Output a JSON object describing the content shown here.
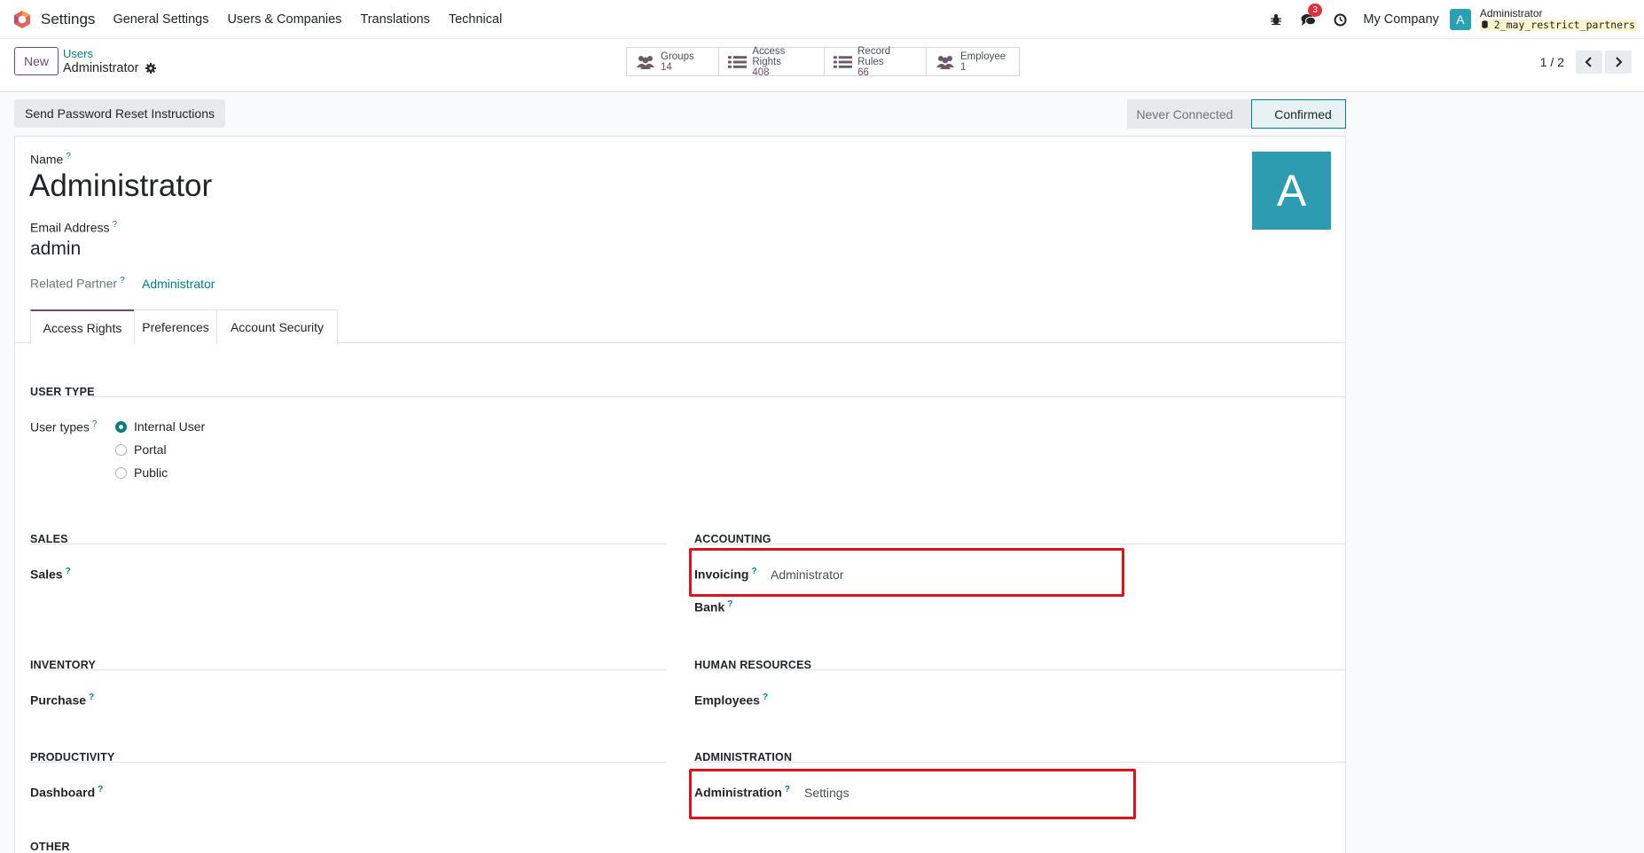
{
  "navbar": {
    "app_name": "Settings",
    "menu": [
      "General Settings",
      "Users & Companies",
      "Translations",
      "Technical"
    ],
    "messages_badge": "3",
    "company": "My Company",
    "avatar_letter": "A",
    "user_name": "Administrator",
    "db_name": "2_may_restrict_partners"
  },
  "control": {
    "new_label": "New",
    "breadcrumb_parent": "Users",
    "breadcrumb_current": "Administrator",
    "stats": [
      {
        "label": "Groups",
        "value": "14",
        "icon": "users-icon"
      },
      {
        "label": "Access Rights",
        "value": "408",
        "icon": "list-icon"
      },
      {
        "label": "Record Rules",
        "value": "66",
        "icon": "list-icon"
      },
      {
        "label": "Employee",
        "value": "1",
        "icon": "users-icon"
      }
    ],
    "pager": "1 / 2"
  },
  "actions": {
    "reset_password": "Send Password Reset Instructions",
    "status_never": "Never Connected",
    "status_confirmed": "Confirmed"
  },
  "form": {
    "name_label": "Name",
    "name_value": "Administrator",
    "email_label": "Email Address",
    "email_value": "admin",
    "partner_label": "Related Partner",
    "partner_value": "Administrator",
    "avatar_letter": "A",
    "help_mark": "?"
  },
  "tabs": [
    "Access Rights",
    "Preferences",
    "Account Security"
  ],
  "sections": {
    "user_type": {
      "title": "USER TYPE",
      "label": "User types",
      "options": [
        "Internal User",
        "Portal",
        "Public"
      ],
      "selected": "Internal User"
    },
    "sales": {
      "title": "SALES",
      "fields": [
        {
          "label": "Sales",
          "value": ""
        }
      ]
    },
    "accounting": {
      "title": "ACCOUNTING",
      "fields": [
        {
          "label": "Invoicing",
          "value": "Administrator"
        },
        {
          "label": "Bank",
          "value": ""
        }
      ]
    },
    "inventory": {
      "title": "INVENTORY",
      "fields": [
        {
          "label": "Purchase",
          "value": ""
        }
      ]
    },
    "human_resources": {
      "title": "HUMAN RESOURCES",
      "fields": [
        {
          "label": "Employees",
          "value": ""
        }
      ]
    },
    "productivity": {
      "title": "PRODUCTIVITY",
      "fields": [
        {
          "label": "Dashboard",
          "value": ""
        }
      ]
    },
    "administration": {
      "title": "ADMINISTRATION",
      "fields": [
        {
          "label": "Administration",
          "value": "Settings"
        }
      ]
    },
    "other": {
      "title": "OTHER"
    }
  },
  "colors": {
    "primary": "#714b67",
    "accent": "#017e84",
    "highlight": "#e0101d",
    "avatar": "#2d9bb0"
  }
}
